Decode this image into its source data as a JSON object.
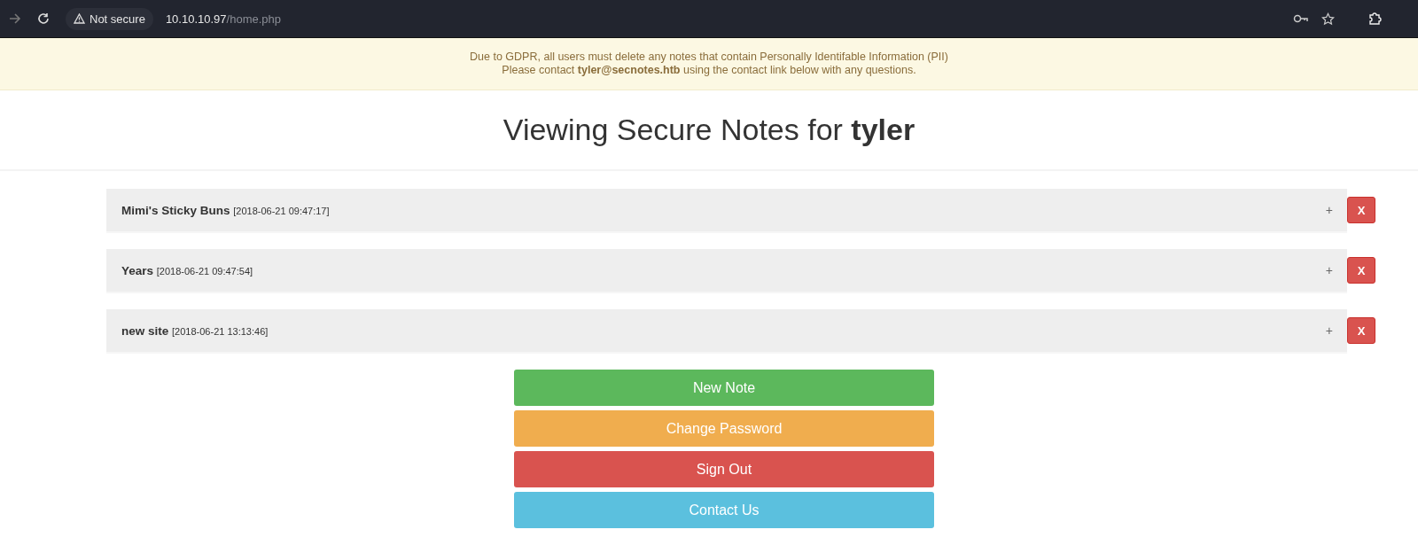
{
  "browser": {
    "security_label": "Not secure",
    "url_host": "10.10.10.97",
    "url_path": "/home.php"
  },
  "banner": {
    "line_1": "Due to GDPR, all users must delete any notes that contain Personally Identifable Information (PII)",
    "line_2": "Please contact **tyler@secnotes.htb** using the contact link below with any questions."
  },
  "heading": "Viewing Secure Notes for **tyler**",
  "notes": [
    {
      "title": "Mimi's Sticky Buns",
      "timestamp": "[2018-06-21 09:47:17]",
      "expand": "+",
      "delete": "X"
    },
    {
      "title": "Years",
      "timestamp": "[2018-06-21 09:47:54]",
      "expand": "+",
      "delete": "X"
    },
    {
      "title": "new site",
      "timestamp": "[2018-06-21 13:13:46]",
      "expand": "+",
      "delete": "X"
    }
  ],
  "buttons": [
    {
      "label": "New Note",
      "kind": "success"
    },
    {
      "label": "Change Password",
      "kind": "warning"
    },
    {
      "label": "Sign Out",
      "kind": "danger"
    },
    {
      "label": "Contact Us",
      "kind": "info"
    }
  ]
}
